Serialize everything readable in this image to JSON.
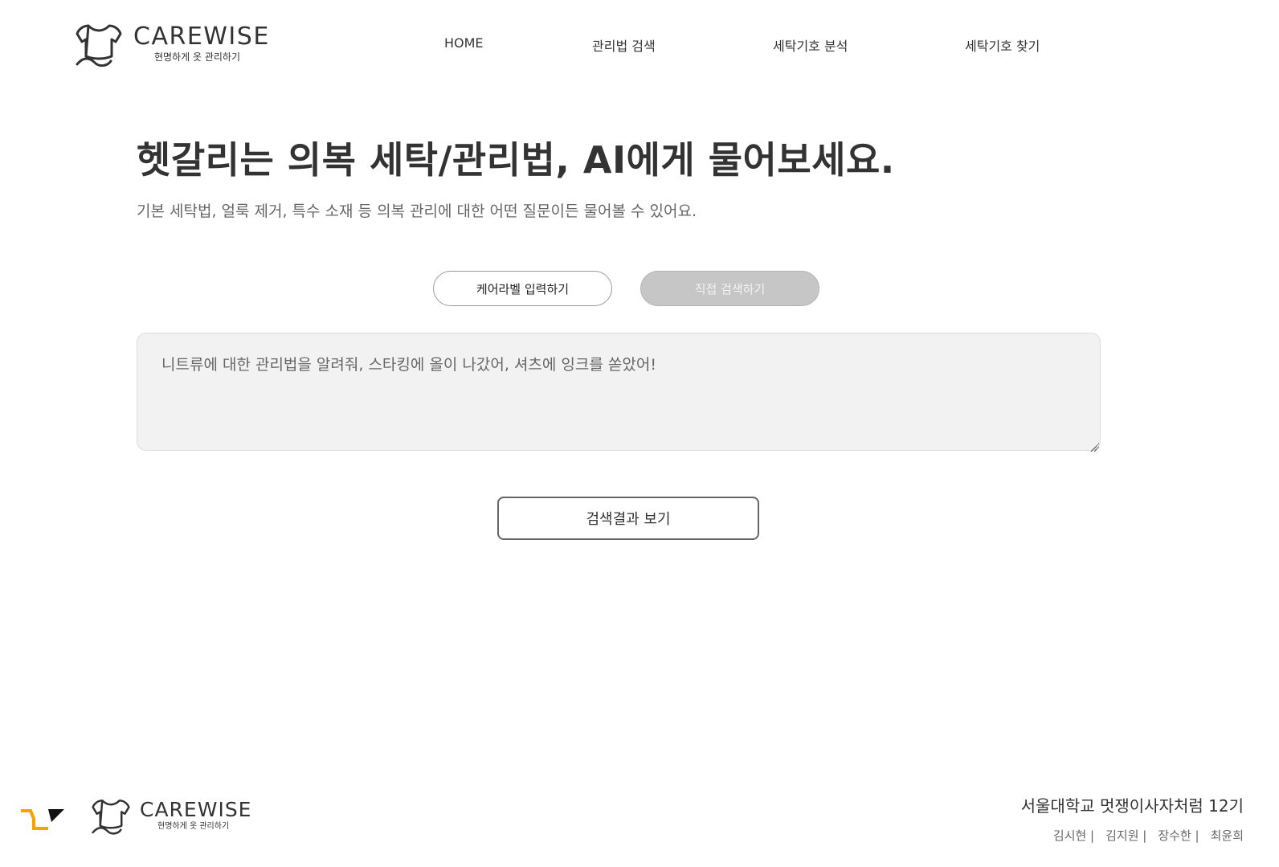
{
  "header": {
    "brand_name": "CAREWISE",
    "brand_tagline": "현명하게 옷 관리하기",
    "nav": {
      "home": "HOME",
      "care_search": "관리법 검색",
      "symbol_analysis": "세탁기호 분석",
      "symbol_find": "세탁기호 찾기"
    }
  },
  "hero": {
    "title": "헷갈리는 의복 세탁/관리법, AI에게 물어보세요.",
    "subtitle": "기본 세탁법, 얼룩 제거, 특수 소재 등 의복 관리에 대한 어떤 질문이든 물어볼 수 있어요."
  },
  "mode_toggle": {
    "label_input": "케어라벨 입력하기",
    "direct_search": "직접 검색하기",
    "active": "direct_search"
  },
  "query": {
    "value": "",
    "placeholder": "니트류에 대한 관리법을 알려줘, 스타킹에 올이 나갔어, 셔츠에 잉크를 쏟았어!"
  },
  "submit_label": "검색결과 보기",
  "footer": {
    "brand_name": "CAREWISE",
    "brand_tagline": "현명하게 옷 관리하기",
    "org": "서울대학교 멋쟁이사자처럼 12기",
    "members": [
      "김시현 |",
      "김지원 |",
      "장수한 |",
      "최윤희"
    ]
  },
  "colors": {
    "text": "#333333",
    "muted": "#666666",
    "inactive_toggle": "#c6c6c6",
    "input_bg": "#f2f2f2",
    "partner_orange": "#f5a300"
  },
  "icons": {
    "brand_logo": "shirt-outline-logo",
    "partner_logo": "likelion-mark"
  }
}
